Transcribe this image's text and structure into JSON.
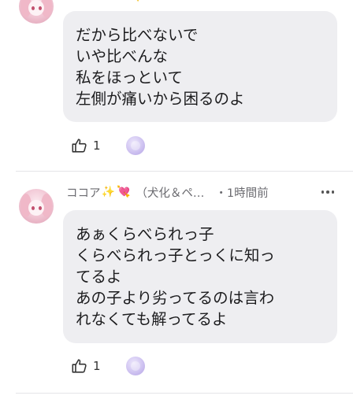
{
  "comments": [
    {
      "name": "",
      "lines": [
        "だから比べないで",
        "いや比べんな",
        "私をほっといて",
        "左側が痛いから困るのよ"
      ],
      "like_count": "1"
    },
    {
      "name": "ココア",
      "name_emojis": [
        "✨",
        "💘"
      ],
      "affiliation": "（犬化＆ペ…",
      "time": "・1時間前",
      "lines": [
        "あぁくらべられっ子",
        "くらべられっ子とっくに知っ",
        "てるよ",
        "あの子より劣ってるのは言わ",
        "れなくても解ってるよ"
      ],
      "like_count": "1"
    }
  ],
  "icons": {
    "like": "thumbs-up-icon",
    "reaction": "reaction-sticker-icon",
    "more": "more-options-icon",
    "avatar": "anime-girl-avatar"
  },
  "colors": {
    "bubble": "#eeeef1",
    "meta_text": "#6b6b70",
    "divider": "#e4e4e8"
  }
}
